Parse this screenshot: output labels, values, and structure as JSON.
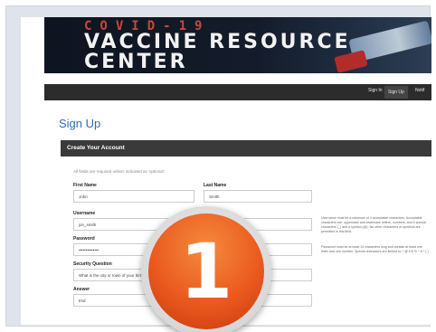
{
  "banner": {
    "line1": "COVID-19",
    "line2": "VACCINE RESOURCE",
    "line3": "CENTER"
  },
  "nav": {
    "items": [
      "Sign In",
      "Sign Up",
      "Notif"
    ]
  },
  "page": {
    "title": "Sign Up",
    "section_header": "Create Your Account",
    "required_note": "All fields are required unless indicated as 'optional'"
  },
  "form": {
    "first_name": {
      "label": "First Name",
      "value": "John"
    },
    "last_name": {
      "label": "Last Name",
      "value": "Smith"
    },
    "username": {
      "label": "Username",
      "value": "jon_smith"
    },
    "password": {
      "label": "Password",
      "value": "••••••••••••••"
    },
    "security_question": {
      "label": "Security Question",
      "value": "What is the city or town of your birth?"
    },
    "answer": {
      "label": "Answer",
      "value": "tmd"
    }
  },
  "hints": {
    "username": "Username must be a minimum of 4 acceptable characters. Acceptable characters are: uppercase and lowercase letters, numbers, and 4 special characters (_) and a symbol (@). No other characters or symbols are permitted in this field.",
    "password": "Password must be at least 14 characters long and contain at least one letter and one number. Special characters are limited to: ! @ # $ % ^ & * ( )"
  },
  "step_badge": {
    "number": "1"
  },
  "colors": {
    "title_blue": "#2a6db5",
    "header_dark": "#3a3a3a",
    "badge_orange": "#ea5a1e",
    "banner_red": "#c7473c"
  }
}
